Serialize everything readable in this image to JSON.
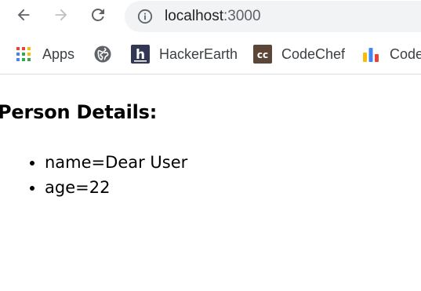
{
  "browser": {
    "url_host": "localhost",
    "url_port": ":3000",
    "bookmarks": {
      "apps": "Apps",
      "hackerearth": "HackerEarth",
      "codechef": "CodeChef",
      "code2": "Code"
    },
    "icons": {
      "back": "back-arrow-icon",
      "forward": "forward-arrow-icon",
      "reload": "reload-icon",
      "info": "info-icon",
      "apps": "apps-grid-icon",
      "globe": "globe-icon",
      "hackerearth": "hackerearth-icon",
      "codechef": "codechef-icon",
      "code2": "bar-chart-icon"
    }
  },
  "page": {
    "heading": "Person Details:",
    "items": [
      "name=Dear User",
      "age=22"
    ]
  }
}
